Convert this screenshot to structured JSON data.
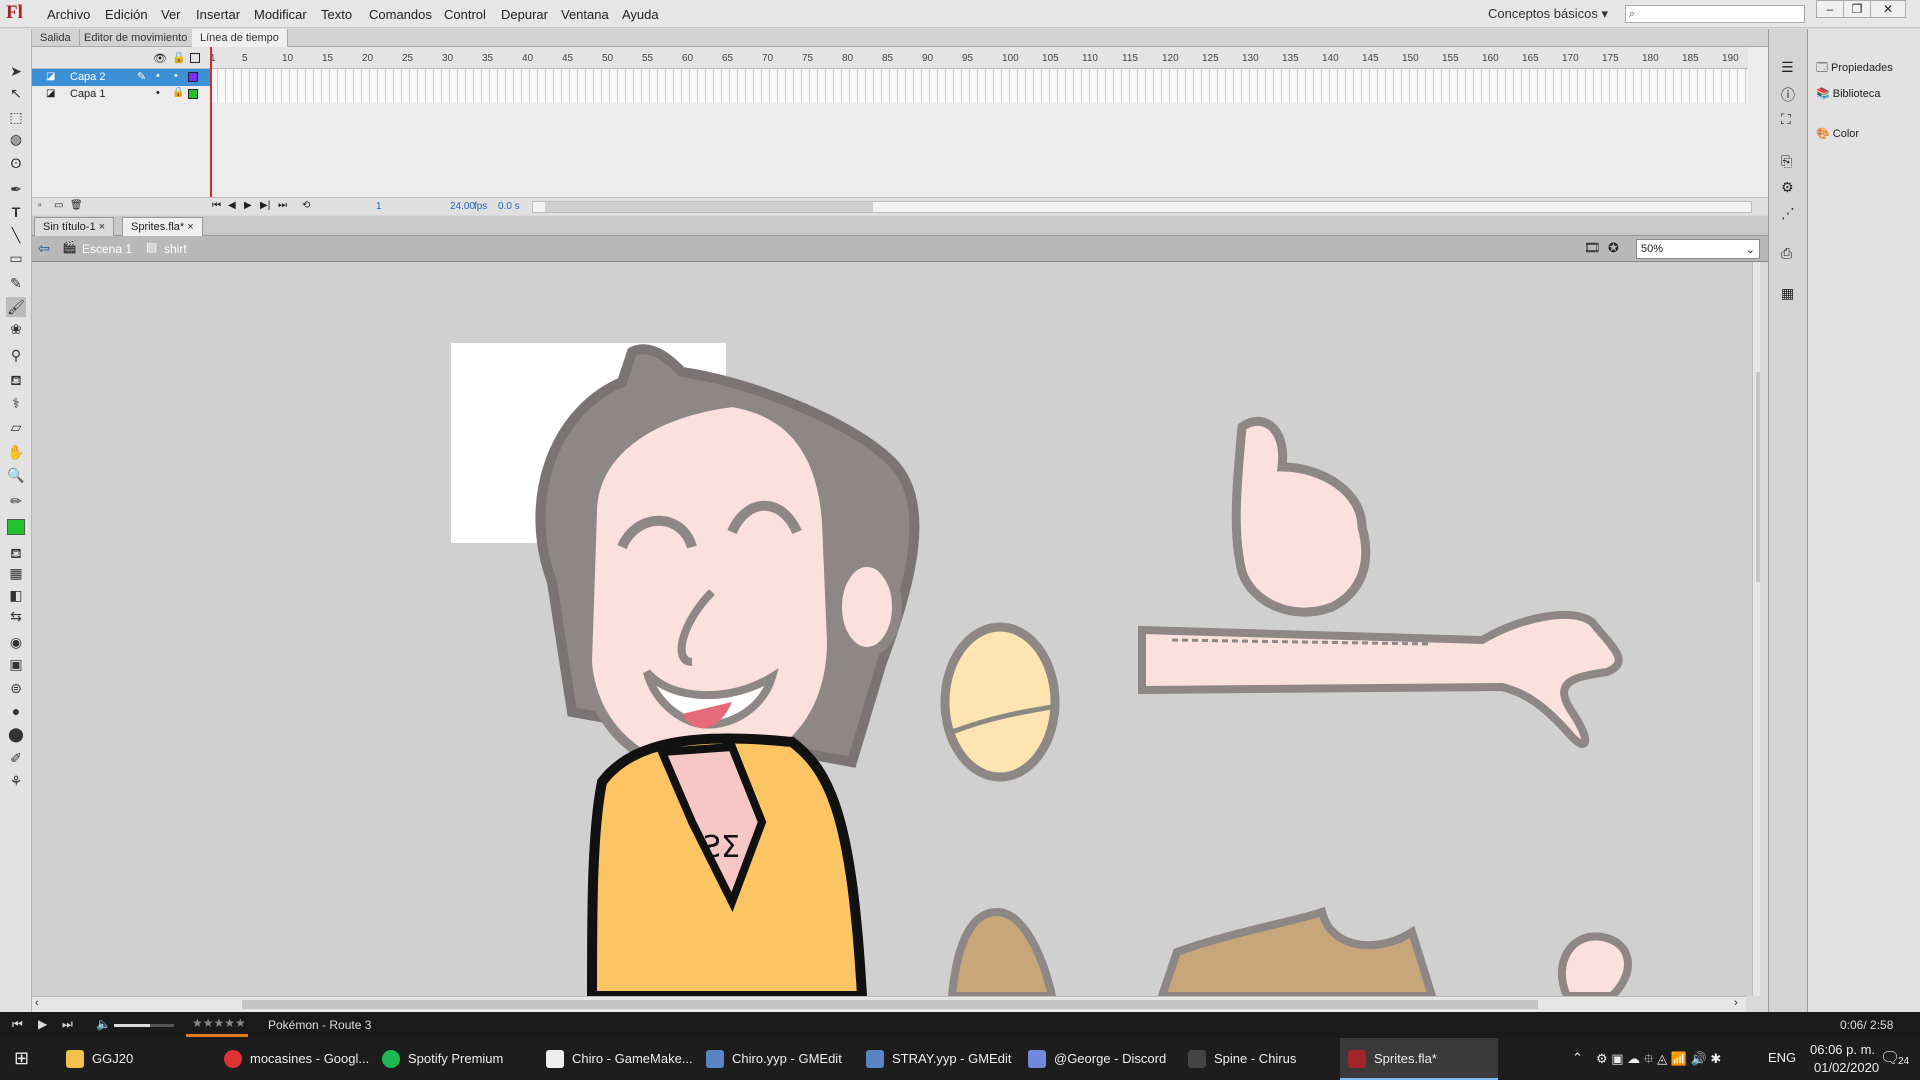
{
  "app": {
    "logo": "Fl"
  },
  "menu": [
    "Archivo",
    "Edición",
    "Ver",
    "Insertar",
    "Modificar",
    "Texto",
    "Comandos",
    "Control",
    "Depurar",
    "Ventana",
    "Ayuda"
  ],
  "workspace": "Conceptos básicos",
  "panel_tabs": [
    "Salida",
    "Editor de movimiento",
    "Línea de tiempo"
  ],
  "timeline": {
    "layers": [
      "Capa 2",
      "Capa 1"
    ],
    "ruler": [
      "1",
      "5",
      "10",
      "15",
      "20",
      "25",
      "30",
      "35",
      "40",
      "45",
      "50",
      "55",
      "60",
      "65",
      "70",
      "75",
      "80",
      "85",
      "90",
      "95",
      "100",
      "105",
      "110",
      "115",
      "120",
      "125",
      "130",
      "135",
      "140",
      "145",
      "150",
      "155",
      "160",
      "165",
      "170",
      "175",
      "180",
      "185",
      "190"
    ],
    "current_frame": "1",
    "fps": "24.00",
    "fps_unit": "fps",
    "time": "0.0 s"
  },
  "doc_tabs": [
    "Sin título-1",
    "Sprites.fla*"
  ],
  "breadcrumb": {
    "scene": "Escena 1",
    "symbol": "shirt"
  },
  "zoom": "50%",
  "right_panel": {
    "properties": "Propiedades",
    "library": "Biblioteca",
    "color": "Color"
  },
  "media": {
    "rating": "★★★★★",
    "track": "Pokémon - Route 3",
    "time": "0:06/ 2:58"
  },
  "taskbar": {
    "items": [
      "GGJ20",
      "mocasines - Googl...",
      "Spotify Premium",
      "Chiro - GameMake...",
      "Chiro.yyp - GMEdit",
      "STRAY.yyp - GMEdit",
      "@George - Discord",
      "Spine - Chirus",
      "Sprites.fla*"
    ],
    "lang": "ENG",
    "time": "06:06 p. m.",
    "date": "01/02/2020",
    "notifications": "24"
  },
  "colors": {
    "stroke_swatch": "#000000",
    "fill_swatch": "#22c22a",
    "layer2_color": "#7c2cff",
    "layer1_color": "#22c22a"
  }
}
